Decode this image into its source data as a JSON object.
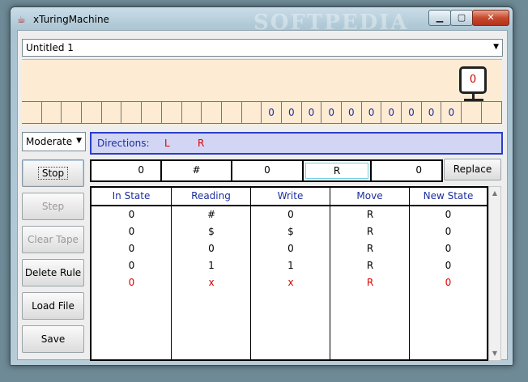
{
  "window": {
    "title": "xTuringMachine",
    "watermark": "SOFTPEDIA",
    "minimize": "▁",
    "maximize": "▢",
    "close": "✕"
  },
  "file_select": {
    "value": "Untitled 1"
  },
  "tape": {
    "head_value": "0",
    "cells": [
      "",
      "",
      "",
      "",
      "",
      "",
      "",
      "",
      "",
      "",
      "",
      "",
      "0",
      "0",
      "0",
      "0",
      "0",
      "0",
      "0",
      "0",
      "0",
      "0",
      "",
      ""
    ]
  },
  "speed_select": {
    "value": "Moderate"
  },
  "directions": {
    "label": "Directions:",
    "left": "L",
    "right": "R"
  },
  "buttons": {
    "stop": "Stop",
    "step": "Step",
    "clear_tape": "Clear Tape",
    "delete_rule": "Delete Rule",
    "load_file": "Load File",
    "save": "Save",
    "replace": "Replace"
  },
  "editor": {
    "in_state": "0",
    "reading": "#",
    "write": "0",
    "move": "R",
    "new_state": "0"
  },
  "table": {
    "headers": [
      "In State",
      "Reading",
      "Write",
      "Move",
      "New State"
    ],
    "rows": [
      [
        "0",
        "#",
        "0",
        "R",
        "0"
      ],
      [
        "0",
        "$",
        "$",
        "R",
        "0"
      ],
      [
        "0",
        "0",
        "0",
        "R",
        "0"
      ],
      [
        "0",
        "1",
        "1",
        "R",
        "0"
      ],
      [
        "0",
        "x",
        "x",
        "R",
        "0"
      ]
    ]
  },
  "colors": {
    "accent": "#2b3ec9",
    "text_blue": "#1c2ea0",
    "highlight_red": "#dd0000",
    "tape_bg": "#fdebd3"
  }
}
